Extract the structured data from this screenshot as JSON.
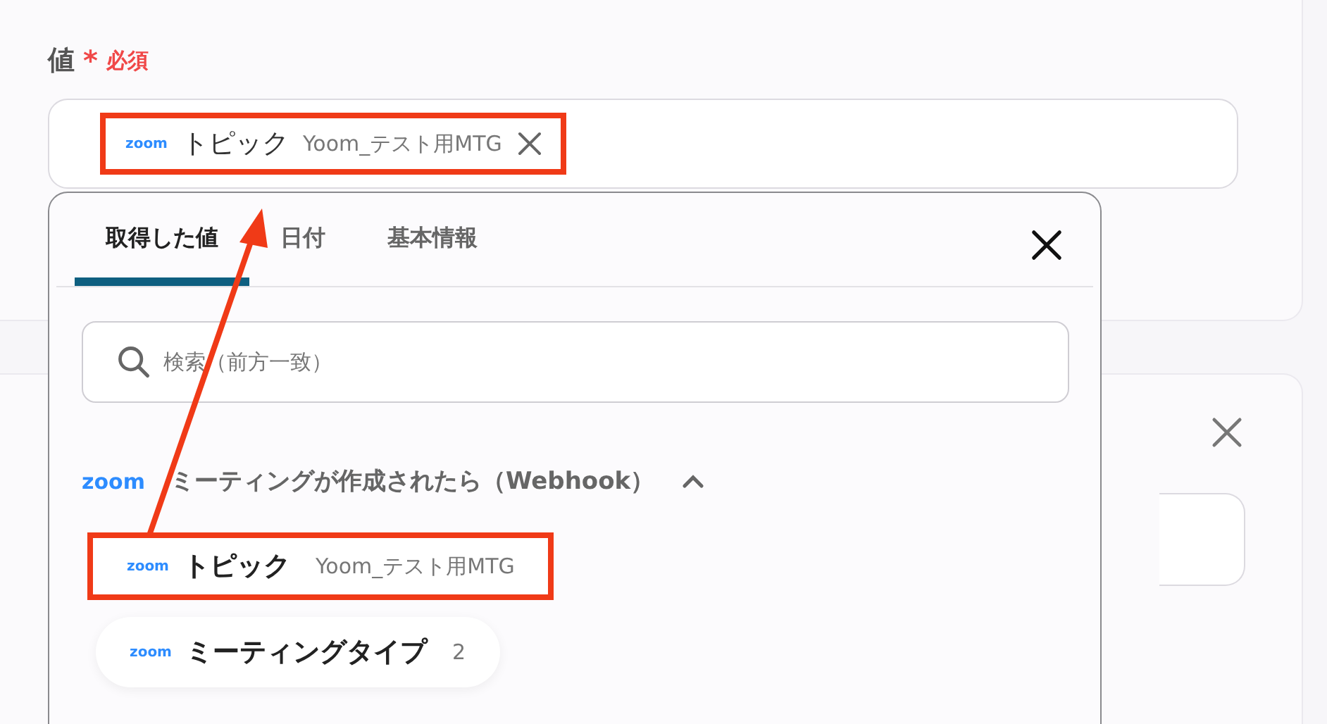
{
  "field": {
    "label": "値",
    "required_mark": "*",
    "required_text": "必須",
    "chip": {
      "logo": "zoom",
      "name": "トピック",
      "value": "Yoom_テスト用MTG",
      "highlighted": true
    }
  },
  "popup": {
    "tabs": [
      {
        "label": "取得した値",
        "selected": true
      },
      {
        "label": "日付",
        "selected": false
      },
      {
        "label": "基本情報",
        "selected": false
      }
    ],
    "search": {
      "placeholder": "検索（前方一致）"
    },
    "group": {
      "logo": "zoom",
      "title": "ミーティングが作成されたら（Webhook）",
      "expanded": true,
      "items": [
        {
          "logo": "zoom",
          "name": "トピック",
          "value": "Yoom_テスト用MTG",
          "highlighted": true
        },
        {
          "logo": "zoom",
          "name": "ミーティングタイプ",
          "value": "2",
          "highlighted": false
        }
      ]
    }
  }
}
